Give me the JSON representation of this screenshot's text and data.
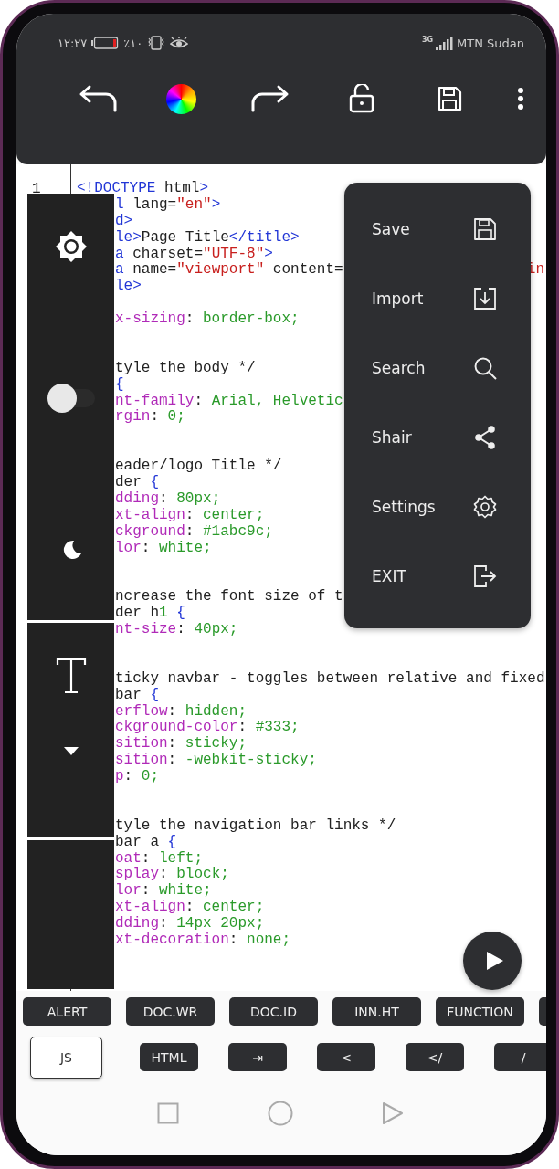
{
  "status_bar": {
    "time": "١٢:٢٧",
    "battery": "٪١٠",
    "network": "3G",
    "carrier": "MTN Sudan"
  },
  "editor": {
    "line_numbers": [
      "1"
    ],
    "lines": [
      {
        "kind": "full",
        "tokens": [
          {
            "kind": "tag",
            "text": "<!DOCTYPE"
          },
          {
            "kind": "text",
            "text": " html"
          },
          {
            "kind": "tag",
            "text": ">"
          }
        ]
      },
      {
        "kind": "cut",
        "tokens": [
          {
            "kind": "tag",
            "text": "l"
          },
          {
            "kind": "text",
            "text": " lang="
          },
          {
            "kind": "str",
            "text": "\"en\""
          },
          {
            "kind": "tag",
            "text": ">"
          }
        ]
      },
      {
        "kind": "cut",
        "tokens": [
          {
            "kind": "tag",
            "text": "d>"
          }
        ]
      },
      {
        "kind": "cut",
        "tokens": [
          {
            "kind": "tag",
            "text": "le>"
          },
          {
            "kind": "text",
            "text": "Page Title"
          },
          {
            "kind": "tag",
            "text": "</title>"
          }
        ]
      },
      {
        "kind": "cut",
        "tokens": [
          {
            "kind": "tag",
            "text": "a"
          },
          {
            "kind": "text",
            "text": " charset="
          },
          {
            "kind": "str",
            "text": "\"UTF-8\""
          },
          {
            "kind": "tag",
            "text": ">"
          }
        ]
      },
      {
        "kind": "cut",
        "tokens": [
          {
            "kind": "tag",
            "text": "a"
          },
          {
            "kind": "text",
            "text": " name="
          },
          {
            "kind": "str",
            "text": "\"viewport\""
          },
          {
            "kind": "text",
            "text": " content="
          }
        ],
        "tail": [
          {
            "kind": "str",
            "text": "in"
          }
        ]
      },
      {
        "kind": "cut",
        "tokens": [
          {
            "kind": "tag",
            "text": "le>"
          }
        ]
      },
      {
        "kind": "blank"
      },
      {
        "kind": "cut",
        "tokens": [
          {
            "kind": "prop",
            "text": "x-sizing"
          },
          {
            "kind": "text",
            "text": ": "
          },
          {
            "kind": "val",
            "text": "border-box;"
          }
        ]
      },
      {
        "kind": "blank"
      },
      {
        "kind": "blank"
      },
      {
        "kind": "cut",
        "tokens": [
          {
            "kind": "text",
            "text": "tyle the body */"
          }
        ]
      },
      {
        "kind": "cut",
        "tokens": [
          {
            "kind": "tag",
            "text": "{"
          }
        ]
      },
      {
        "kind": "cut",
        "tokens": [
          {
            "kind": "prop",
            "text": "nt-family"
          },
          {
            "kind": "text",
            "text": ": "
          },
          {
            "kind": "val",
            "text": "Arial, Helvetic"
          }
        ]
      },
      {
        "kind": "cut",
        "tokens": [
          {
            "kind": "prop",
            "text": "rgin"
          },
          {
            "kind": "text",
            "text": ": "
          },
          {
            "kind": "val",
            "text": "0;"
          }
        ]
      },
      {
        "kind": "blank"
      },
      {
        "kind": "blank"
      },
      {
        "kind": "cut",
        "tokens": [
          {
            "kind": "text",
            "text": "eader/logo Title */"
          }
        ]
      },
      {
        "kind": "cut",
        "tokens": [
          {
            "kind": "text",
            "text": "der "
          },
          {
            "kind": "tag",
            "text": "{"
          }
        ]
      },
      {
        "kind": "cut",
        "tokens": [
          {
            "kind": "prop",
            "text": "dding"
          },
          {
            "kind": "text",
            "text": ": "
          },
          {
            "kind": "val",
            "text": "80px;"
          }
        ]
      },
      {
        "kind": "cut",
        "tokens": [
          {
            "kind": "prop",
            "text": "xt-align"
          },
          {
            "kind": "text",
            "text": ": "
          },
          {
            "kind": "val",
            "text": "center;"
          }
        ]
      },
      {
        "kind": "cut",
        "tokens": [
          {
            "kind": "prop",
            "text": "ckground"
          },
          {
            "kind": "text",
            "text": ": "
          },
          {
            "kind": "val",
            "text": "#1abc9c;"
          }
        ]
      },
      {
        "kind": "cut",
        "tokens": [
          {
            "kind": "prop",
            "text": "lor"
          },
          {
            "kind": "text",
            "text": ": "
          },
          {
            "kind": "val",
            "text": "white;"
          }
        ]
      },
      {
        "kind": "blank"
      },
      {
        "kind": "blank"
      },
      {
        "kind": "cut",
        "tokens": [
          {
            "kind": "text",
            "text": "ncrease the font size of t"
          }
        ]
      },
      {
        "kind": "cut",
        "tokens": [
          {
            "kind": "text",
            "text": "der h"
          },
          {
            "kind": "val",
            "text": "1"
          },
          {
            "kind": "tag",
            "text": " {"
          }
        ]
      },
      {
        "kind": "cut",
        "tokens": [
          {
            "kind": "prop",
            "text": "nt-size"
          },
          {
            "kind": "text",
            "text": ": "
          },
          {
            "kind": "val",
            "text": "40px;"
          }
        ]
      },
      {
        "kind": "blank"
      },
      {
        "kind": "blank"
      },
      {
        "kind": "cut",
        "tokens": [
          {
            "kind": "text",
            "text": "ticky navbar - toggles between relative and fixed"
          }
        ]
      },
      {
        "kind": "cut",
        "tokens": [
          {
            "kind": "text",
            "text": "bar "
          },
          {
            "kind": "tag",
            "text": "{"
          }
        ]
      },
      {
        "kind": "cut",
        "tokens": [
          {
            "kind": "prop",
            "text": "erflow"
          },
          {
            "kind": "text",
            "text": ": "
          },
          {
            "kind": "val",
            "text": "hidden;"
          }
        ]
      },
      {
        "kind": "cut",
        "tokens": [
          {
            "kind": "prop",
            "text": "ckground-color"
          },
          {
            "kind": "text",
            "text": ": "
          },
          {
            "kind": "val",
            "text": "#333;"
          }
        ]
      },
      {
        "kind": "cut",
        "tokens": [
          {
            "kind": "prop",
            "text": "sition"
          },
          {
            "kind": "text",
            "text": ": "
          },
          {
            "kind": "val",
            "text": "sticky;"
          }
        ]
      },
      {
        "kind": "cut",
        "tokens": [
          {
            "kind": "prop",
            "text": "sition"
          },
          {
            "kind": "text",
            "text": ": "
          },
          {
            "kind": "val",
            "text": "-webkit-sticky;"
          }
        ]
      },
      {
        "kind": "cut",
        "tokens": [
          {
            "kind": "prop",
            "text": "p"
          },
          {
            "kind": "text",
            "text": ": "
          },
          {
            "kind": "val",
            "text": "0;"
          }
        ]
      },
      {
        "kind": "blank"
      },
      {
        "kind": "blank"
      },
      {
        "kind": "cut",
        "tokens": [
          {
            "kind": "text",
            "text": "tyle the navigation bar links */"
          }
        ]
      },
      {
        "kind": "cut",
        "tokens": [
          {
            "kind": "text",
            "text": "bar a "
          },
          {
            "kind": "tag",
            "text": "{"
          }
        ]
      },
      {
        "kind": "cut",
        "tokens": [
          {
            "kind": "prop",
            "text": "oat"
          },
          {
            "kind": "text",
            "text": ": "
          },
          {
            "kind": "val",
            "text": "left;"
          }
        ]
      },
      {
        "kind": "cut",
        "tokens": [
          {
            "kind": "prop",
            "text": "splay"
          },
          {
            "kind": "text",
            "text": ": "
          },
          {
            "kind": "val",
            "text": "block;"
          }
        ]
      },
      {
        "kind": "cut",
        "tokens": [
          {
            "kind": "prop",
            "text": "lor"
          },
          {
            "kind": "text",
            "text": ": "
          },
          {
            "kind": "val",
            "text": "white;"
          }
        ]
      },
      {
        "kind": "cut",
        "tokens": [
          {
            "kind": "prop",
            "text": "xt-align"
          },
          {
            "kind": "text",
            "text": ": "
          },
          {
            "kind": "val",
            "text": "center;"
          }
        ]
      },
      {
        "kind": "cut",
        "tokens": [
          {
            "kind": "prop",
            "text": "dding"
          },
          {
            "kind": "text",
            "text": ": "
          },
          {
            "kind": "val",
            "text": "14px 20px;"
          }
        ]
      },
      {
        "kind": "cut",
        "tokens": [
          {
            "kind": "prop",
            "text": "xt-decoration"
          },
          {
            "kind": "text",
            "text": ": "
          },
          {
            "kind": "val",
            "text": "none;"
          }
        ]
      }
    ]
  },
  "side_panel": {
    "dark_mode": {
      "on": false
    }
  },
  "menu": {
    "items": [
      {
        "kind": "save",
        "label": "Save"
      },
      {
        "kind": "import",
        "label": "Import"
      },
      {
        "kind": "search",
        "label": "Search"
      },
      {
        "kind": "share",
        "label": "Shair"
      },
      {
        "kind": "settings",
        "label": "Settings"
      },
      {
        "kind": "exit",
        "label": "EXIT"
      }
    ]
  },
  "snippet_keys": [
    "ALERT",
    "DOC.WR",
    "DOC.ID",
    "INN.HT",
    "FUNCTION"
  ],
  "tag_keys": [
    {
      "label": "JS",
      "selected": true
    },
    {
      "label": "HTML",
      "selected": false
    },
    {
      "label": "⇥",
      "selected": false
    },
    {
      "label": "<",
      "selected": false
    },
    {
      "label": "</",
      "selected": false
    },
    {
      "label": "/",
      "selected": false
    }
  ]
}
